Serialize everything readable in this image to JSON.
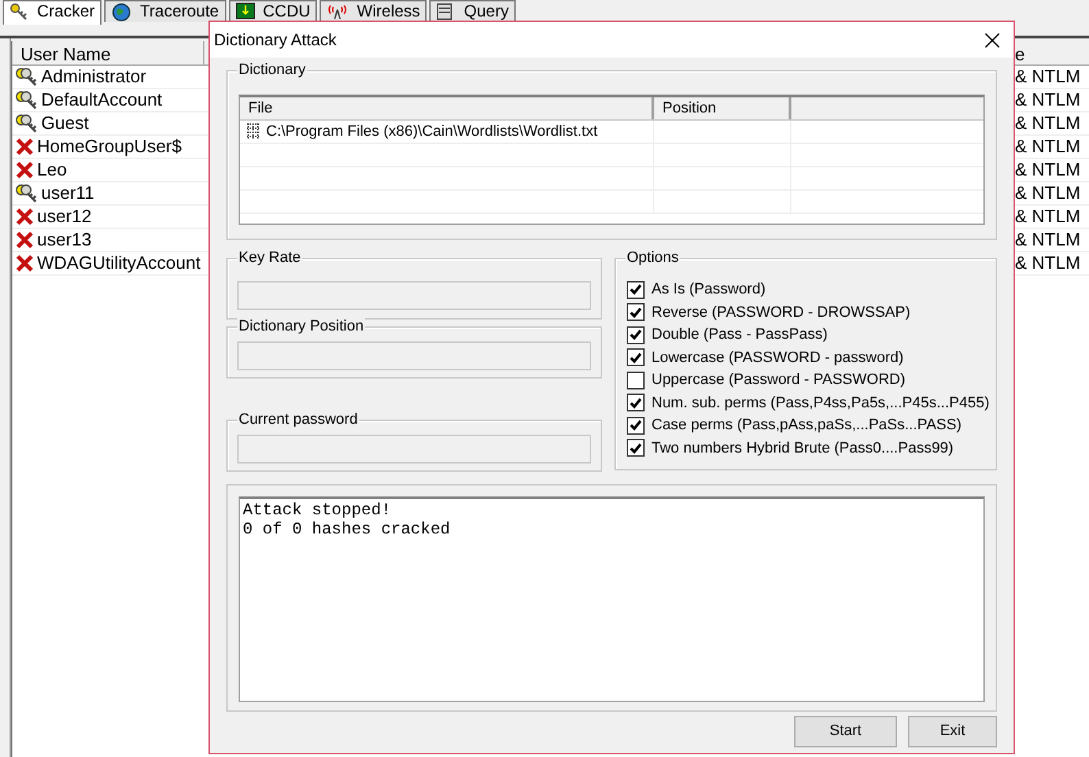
{
  "tabs": [
    {
      "label": "Cracker",
      "kind": "keys",
      "selected": true
    },
    {
      "label": "Traceroute",
      "kind": "globe",
      "selected": false
    },
    {
      "label": "CCDU",
      "kind": "board",
      "selected": false
    },
    {
      "label": "Wireless",
      "kind": "antenna",
      "selected": false
    },
    {
      "label": "Query",
      "kind": "server",
      "selected": false
    }
  ],
  "table": {
    "columns": [
      "User Name",
      "e"
    ],
    "rows": [
      {
        "name": "Administrator",
        "kind": "key",
        "column_2": "& NTLM"
      },
      {
        "name": "DefaultAccount",
        "kind": "key",
        "column_2": "& NTLM"
      },
      {
        "name": "Guest",
        "kind": "key",
        "column_2": "& NTLM"
      },
      {
        "name": "HomeGroupUser$",
        "kind": "cross",
        "column_2": "& NTLM"
      },
      {
        "name": "Leo",
        "kind": "cross",
        "column_2": "& NTLM"
      },
      {
        "name": "user11",
        "kind": "key",
        "column_2": "& NTLM"
      },
      {
        "name": "user12",
        "kind": "cross",
        "column_2": "& NTLM"
      },
      {
        "name": "user13",
        "kind": "cross",
        "column_2": "& NTLM"
      },
      {
        "name": "WDAGUtilityAccount",
        "kind": "cross",
        "column_2": "& NTLM"
      }
    ]
  },
  "dialog": {
    "title": "Dictionary Attack",
    "dictionary": {
      "title": "Dictionary",
      "columns": [
        "File",
        "Position"
      ],
      "rows": [
        {
          "file": "C:\\Program Files (x86)\\Cain\\Wordlists\\Wordlist.txt"
        }
      ]
    },
    "key_rate": {
      "label": "Key Rate"
    },
    "dictionary_position": {
      "label": "Dictionary Position"
    },
    "current_password": {
      "label": "Current password"
    },
    "options": {
      "title": "Options",
      "items": [
        {
          "label": "As Is (Password)",
          "checked": true
        },
        {
          "label": "Reverse (PASSWORD - DROWSSAP)",
          "checked": true
        },
        {
          "label": "Double (Pass - PassPass)",
          "checked": true
        },
        {
          "label": "Lowercase (PASSWORD - password)",
          "checked": true
        },
        {
          "label": "Uppercase (Password - PASSWORD)",
          "checked": false
        },
        {
          "label": "Num. sub. perms (Pass,P4ss,Pa5s,...P45s...P455)",
          "checked": true
        },
        {
          "label": "Case perms (Pass,pAss,paSs,...PaSs...PASS)",
          "checked": true
        },
        {
          "label": "Two numbers Hybrid Brute (Pass0....Pass99)",
          "checked": true
        }
      ]
    },
    "log": [
      "Attack stopped!",
      "0 of 0 hashes cracked"
    ],
    "buttons": [
      "Start",
      "Exit"
    ]
  }
}
